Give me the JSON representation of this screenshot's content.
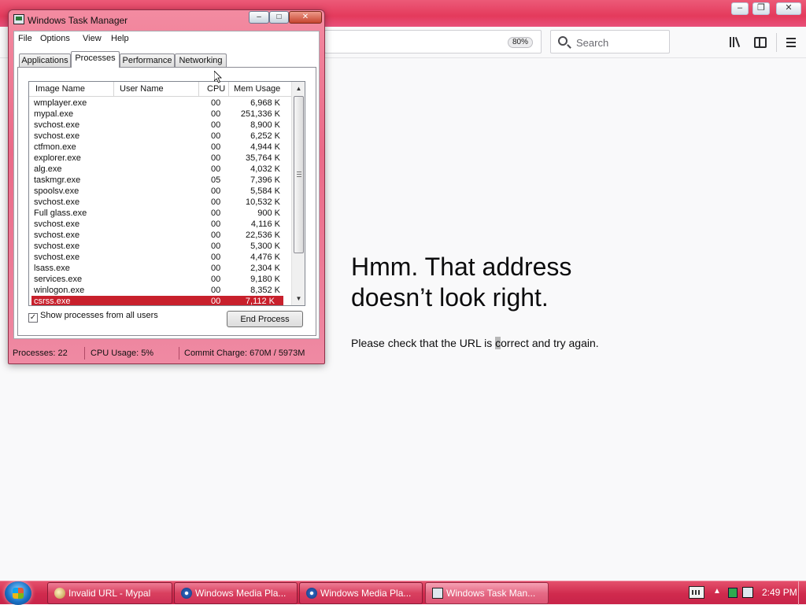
{
  "browser": {
    "zoom": "80%",
    "search_placeholder": "Search",
    "error": {
      "heading_line1": "Hmm. That address",
      "heading_line2": "doesn’t look right.",
      "message_before": "Please check that the URL is ",
      "message_selected": "c",
      "message_after": "orrect and try again."
    },
    "window_controls": {
      "minimize": "–",
      "restore": "❐",
      "close": "✕"
    }
  },
  "task_manager": {
    "title": "Windows Task Manager",
    "controls": {
      "minimize": "–",
      "maximize": "□",
      "close": "✕"
    },
    "menu": [
      "File",
      "Options",
      "View",
      "Help"
    ],
    "tabs": [
      "Applications",
      "Processes",
      "Performance",
      "Networking"
    ],
    "active_tab": "Processes",
    "columns": {
      "image": "Image Name",
      "user": "User Name",
      "cpu": "CPU",
      "mem": "Mem Usage"
    },
    "processes": [
      {
        "image": "wmplayer.exe",
        "cpu": "00",
        "mem": "6,968 K"
      },
      {
        "image": "mypal.exe",
        "cpu": "00",
        "mem": "251,336 K"
      },
      {
        "image": "svchost.exe",
        "cpu": "00",
        "mem": "8,900 K"
      },
      {
        "image": "svchost.exe",
        "cpu": "00",
        "mem": "6,252 K"
      },
      {
        "image": "ctfmon.exe",
        "cpu": "00",
        "mem": "4,944 K"
      },
      {
        "image": "explorer.exe",
        "cpu": "00",
        "mem": "35,764 K"
      },
      {
        "image": "alg.exe",
        "cpu": "00",
        "mem": "4,032 K"
      },
      {
        "image": "taskmgr.exe",
        "cpu": "05",
        "mem": "7,396 K"
      },
      {
        "image": "spoolsv.exe",
        "cpu": "00",
        "mem": "5,584 K"
      },
      {
        "image": "svchost.exe",
        "cpu": "00",
        "mem": "10,532 K"
      },
      {
        "image": "Full glass.exe",
        "cpu": "00",
        "mem": "900 K"
      },
      {
        "image": "svchost.exe",
        "cpu": "00",
        "mem": "4,116 K"
      },
      {
        "image": "svchost.exe",
        "cpu": "00",
        "mem": "22,536 K"
      },
      {
        "image": "svchost.exe",
        "cpu": "00",
        "mem": "5,300 K"
      },
      {
        "image": "svchost.exe",
        "cpu": "00",
        "mem": "4,476 K"
      },
      {
        "image": "lsass.exe",
        "cpu": "00",
        "mem": "2,304 K"
      },
      {
        "image": "services.exe",
        "cpu": "00",
        "mem": "9,180 K"
      },
      {
        "image": "winlogon.exe",
        "cpu": "00",
        "mem": "8,352 K"
      },
      {
        "image": "csrss.exe",
        "cpu": "00",
        "mem": "7,112 K",
        "selected": true
      }
    ],
    "show_all_label": "Show processes from all users",
    "show_all_checked": true,
    "end_process_label": "End Process",
    "status": {
      "processes": "Processes: 22",
      "cpu_usage": "CPU Usage: 5%",
      "commit_charge": "Commit Charge: 670M / 5973M"
    }
  },
  "taskbar": {
    "buttons": [
      {
        "label": "Invalid URL - Mypal",
        "icon": "mypal-icon"
      },
      {
        "label": "Windows Media Pla...",
        "icon": "media-player-icon"
      },
      {
        "label": "Windows Media Pla...",
        "icon": "media-player-icon"
      },
      {
        "label": "Windows Task Man...",
        "icon": "task-manager-icon",
        "active": true
      }
    ],
    "tray_up_arrow": "▲",
    "clock": "2:49 PM"
  },
  "colors": {
    "accent": "#e43a5c",
    "selection": "#c8202c"
  }
}
